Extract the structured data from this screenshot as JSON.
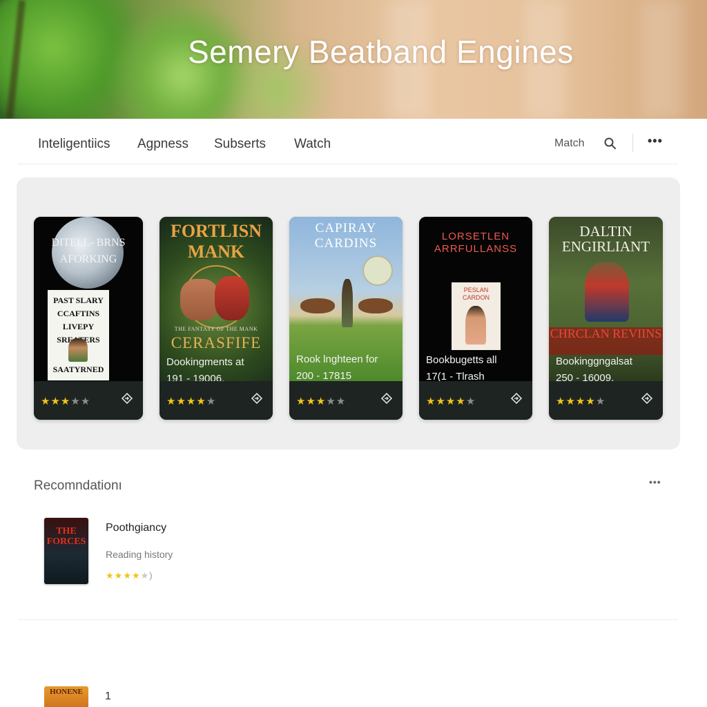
{
  "hero": {
    "title": "Semery Beatband Engines"
  },
  "nav": {
    "links": [
      "Inteligentiics",
      "Agpness",
      "Subserts",
      "Watch"
    ],
    "right_label": "Match",
    "search_icon": "search-icon",
    "more_icon": "more-horizontal-icon",
    "more_glyph": "•••"
  },
  "books": [
    {
      "cover_title": "DITELL- BRNS AFORKING",
      "cover_subtitle": "PAST SLARY CCAFTINS LIVEPY SREATERS",
      "cover_bottom": "SAATYRNED",
      "caption_line1": "",
      "caption_line2": "",
      "rating": 3,
      "max_rating": 5
    },
    {
      "cover_title": "FORTLISN MANK",
      "cover_subtitle": "THE FANTASY OF THE MANK",
      "cover_bottom": "CERASFIFE",
      "caption_line1": "Dookingments at",
      "caption_line2": "191 - 19006,",
      "rating": 3.5,
      "max_rating": 5
    },
    {
      "cover_title": "CAPIRAY CARDINS",
      "cover_subtitle": "",
      "cover_bottom": "",
      "caption_line1": "Rook lnghteen for",
      "caption_line2": "200 - 17815",
      "rating": 2.5,
      "max_rating": 5
    },
    {
      "cover_title": "LORSETLEN ARRFULLANSS",
      "cover_subtitle": "PESLAN CARDON",
      "cover_bottom": "",
      "caption_line1": "Bookbugetts all",
      "caption_line2": "17(1 - Tlrash",
      "rating": 4,
      "max_rating": 5
    },
    {
      "cover_title": "DALTIN ENGIRLIANT",
      "cover_subtitle": "",
      "cover_bottom": "CHRCLAN REVIINS",
      "caption_line1": "Bookinggngalsat",
      "caption_line2": "250 - 16009,",
      "rating": 4,
      "max_rating": 5
    }
  ],
  "card_action_icon": "bookmark-diamond-icon",
  "recommendations": {
    "heading": "Recomndationı",
    "more_glyph": "•••",
    "items": [
      {
        "thumb_title": "THE FORCES",
        "title": "Poothgiancy",
        "subtitle": "Reading history",
        "rating": 4,
        "max_rating": 5,
        "rating_suffix": ")"
      }
    ],
    "second": {
      "thumb_title": "HONENE",
      "number": "1"
    }
  },
  "colors": {
    "star": "#f2c318",
    "card_bg": "#1d2421",
    "panel_bg": "#eeeeee"
  }
}
